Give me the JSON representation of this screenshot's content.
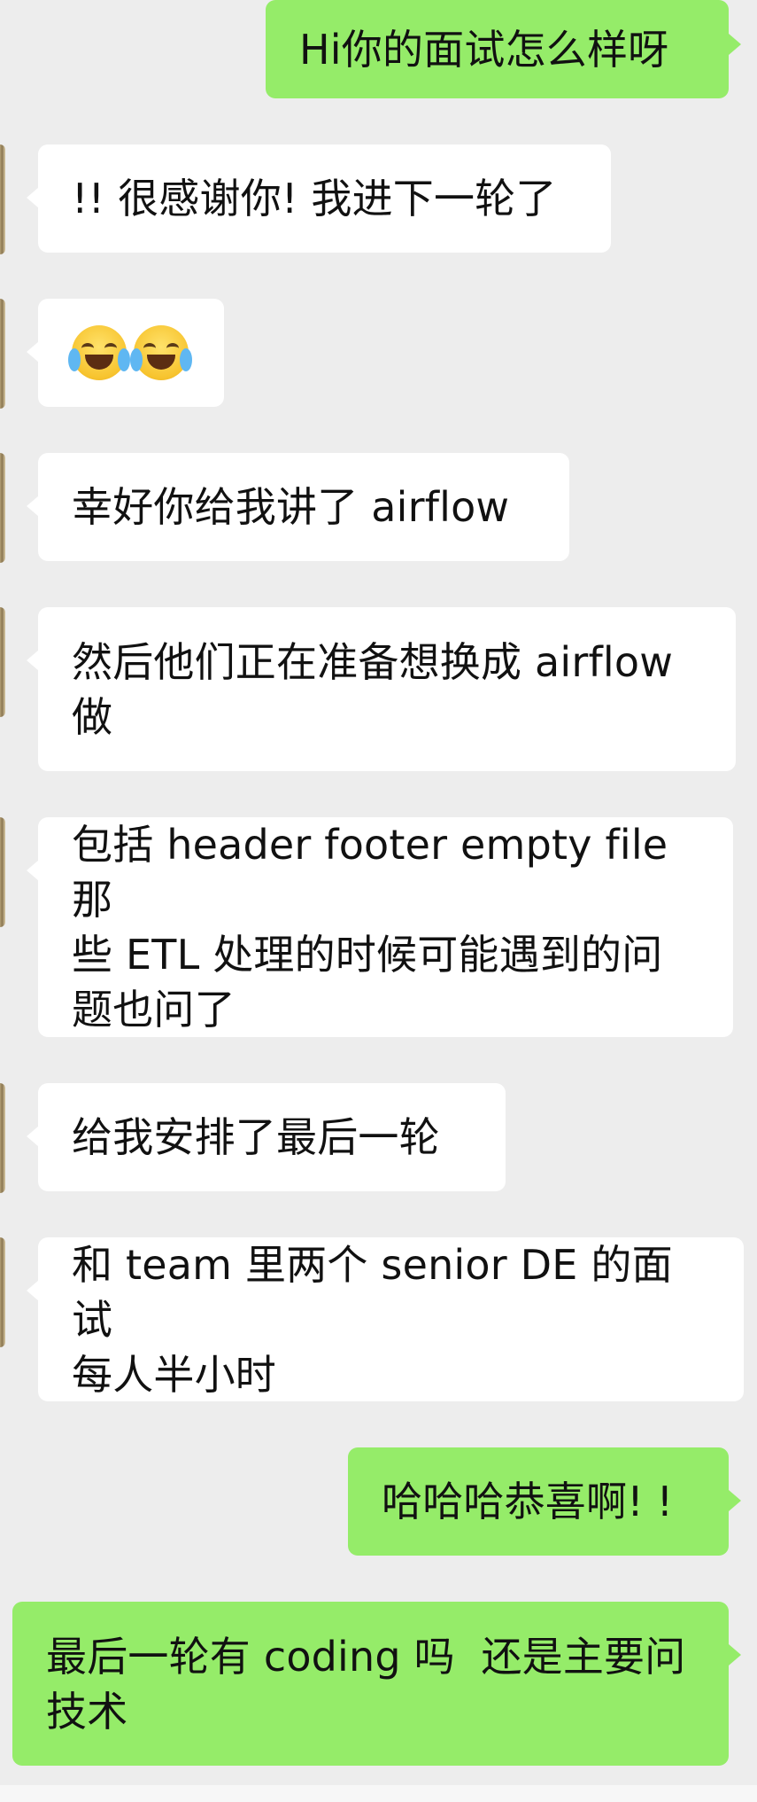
{
  "messages": [
    {
      "side": "out",
      "text": "Hi你的面试怎么样呀"
    },
    {
      "side": "in",
      "text": "!! 很感谢你! 我进下一轮了"
    },
    {
      "side": "in",
      "emojis": [
        "tears-of-joy",
        "tears-of-joy"
      ]
    },
    {
      "side": "in",
      "text": "幸好你给我讲了 airflow"
    },
    {
      "side": "in",
      "text": "然后他们正在准备想换成 airflow\n做"
    },
    {
      "side": "in",
      "text": "包括 header footer empty file 那\n些 ETL 处理的时候可能遇到的问\n题也问了"
    },
    {
      "side": "in",
      "text": "给我安排了最后一轮"
    },
    {
      "side": "in",
      "text": "和 team 里两个 senior DE 的面试\n每人半小时"
    },
    {
      "side": "out",
      "text": "哈哈哈恭喜啊! !"
    },
    {
      "side": "out",
      "text": "最后一轮有 coding 吗  还是主要问\n技术"
    }
  ],
  "colors": {
    "background": "#ededed",
    "incoming_bubble": "#ffffff",
    "outgoing_bubble": "#95ec69",
    "text": "#111111"
  }
}
